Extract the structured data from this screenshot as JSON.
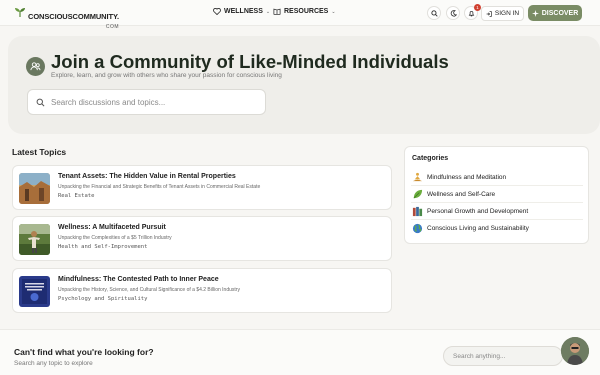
{
  "header": {
    "logo_text": "CONSCIOUSCOMMUNITY.",
    "logo_sub": "COM",
    "nav": [
      {
        "label": "WELLNESS",
        "icon": "heart-icon"
      },
      {
        "label": "RESOURCES",
        "icon": "book-icon"
      }
    ],
    "notification_count": "1",
    "signin_label": "SIGN IN",
    "discover_label": "DISCOVER"
  },
  "hero": {
    "title": "Join a Community of Like-Minded Individuals",
    "subtitle": "Explore, learn, and grow with others who share your passion for conscious living",
    "search_placeholder": "Search discussions and topics..."
  },
  "topics": {
    "heading": "Latest Topics",
    "items": [
      {
        "title": "Tenant Assets: The Hidden Value in Rental Properties",
        "subtitle": "Unpacking the Financial and Strategic Benefits of Tenant Assets in Commercial Real Estate",
        "category": "Real Estate"
      },
      {
        "title": "Wellness: A Multifaceted Pursuit",
        "subtitle": "Unpacking the Complexities of a $5 Trillion Industry",
        "category": "Health and Self-Improvement"
      },
      {
        "title": "Mindfulness: The Contested Path to Inner Peace",
        "subtitle": "Unpacking the History, Science, and Cultural Significance of a $4.2 Billion Industry",
        "category": "Psychology and Spirituality"
      }
    ]
  },
  "categories": {
    "heading": "Categories",
    "items": [
      {
        "label": "Mindfulness and Meditation",
        "icon": "meditation-icon"
      },
      {
        "label": "Wellness and Self-Care",
        "icon": "leaf-icon"
      },
      {
        "label": "Personal Growth and Development",
        "icon": "books-icon"
      },
      {
        "label": "Conscious Living and Sustainability",
        "icon": "globe-icon"
      }
    ]
  },
  "footer": {
    "title": "Can't find what you're looking for?",
    "subtitle": "Search any topic to explore",
    "search_placeholder": "Search anything..."
  },
  "colors": {
    "accent": "#7a8c65",
    "badge": "#d04030"
  }
}
